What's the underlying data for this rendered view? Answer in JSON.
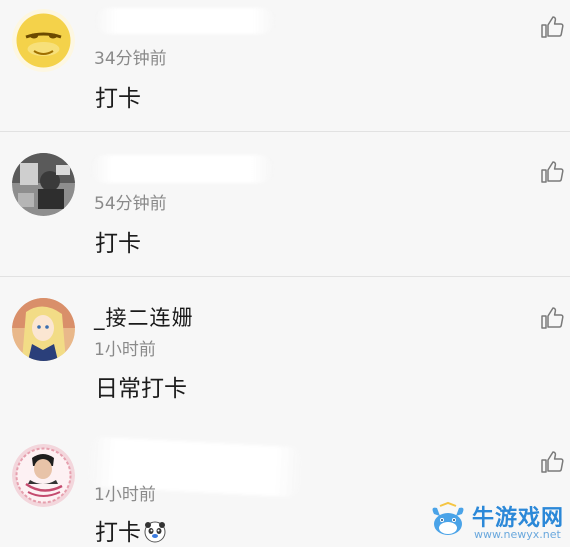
{
  "comments": [
    {
      "username": "",
      "time": "34分钟前",
      "content": "打卡",
      "avatar_icon": "duck-avatar-icon"
    },
    {
      "username": "",
      "time": "54分钟前",
      "content": "打卡",
      "avatar_icon": "photo-avatar-icon"
    },
    {
      "username": "_接二连姗",
      "time": "1小时前",
      "content": "日常打卡",
      "avatar_icon": "anime-avatar-icon"
    },
    {
      "username": "",
      "time": "1小时前",
      "content": "打卡",
      "avatar_icon": "portrait-avatar-icon",
      "emoji": "panda-emoji-icon"
    }
  ],
  "like_icon": "thumbs-up-icon",
  "watermark": {
    "name": "牛游戏网",
    "url": "www.newyx.net"
  },
  "colors": {
    "background": "#f7f7f7",
    "divider": "#e2e2e2",
    "time": "#8a8a8a",
    "watermark": "#2b88d8"
  }
}
